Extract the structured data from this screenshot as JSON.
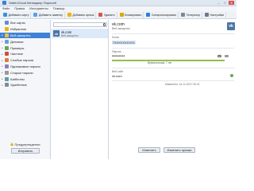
{
  "window": {
    "title": "SafeInCloud Менеджер Паролей",
    "buttons": {
      "minimize": "–",
      "maximize": "□",
      "close": "✕"
    }
  },
  "menu": [
    "Файл",
    "Правка",
    "Инструменты",
    "Помощь"
  ],
  "toolbar": [
    {
      "label": "Добавить карту",
      "icon": "add-card-icon",
      "color": "#3b8ee0"
    },
    {
      "label": "Добавить заметку",
      "icon": "add-note-icon",
      "color": "#5ba0e6"
    },
    {
      "label": "Добавить ярлык",
      "icon": "add-label-icon",
      "color": "#f0b400"
    },
    {
      "label": "Удалить",
      "icon": "delete-icon",
      "color": "#d9534f"
    },
    {
      "label": "Блокировать",
      "icon": "lock-icon",
      "color": "#e0a800"
    },
    {
      "label": "Синхронизировать",
      "icon": "sync-icon",
      "color": "#2f7de1"
    },
    {
      "label": "Генератор",
      "icon": "generator-icon",
      "color": "#7b8a99"
    },
    {
      "label": "Настройки",
      "icon": "settings-icon",
      "color": "#6c7a89"
    }
  ],
  "sidebar": {
    "categories": [
      {
        "label": "Все карты",
        "icon": "all-cards-icon",
        "color": "#5b8fd6",
        "active": false
      },
      {
        "label": "Избранное",
        "icon": "star-icon",
        "color": "#f0b400",
        "active": false
      },
      {
        "label": "Веб-аккаунты",
        "icon": "folder-icon",
        "color": "#e8c04a",
        "active": true
      },
      {
        "label": "Деловые",
        "icon": "folder-icon",
        "color": "#6a9fd8",
        "active": false
      },
      {
        "label": "Примеры",
        "icon": "folder-icon",
        "color": "#6aa84f",
        "active": false
      },
      {
        "label": "Частные",
        "icon": "folder-icon",
        "color": "#cc4b4b",
        "active": false
      },
      {
        "label": "Слабые пароли",
        "icon": "weak-icon",
        "color": "#e07b39",
        "active": false
      },
      {
        "label": "Одинаковые пароли",
        "icon": "duplicate-icon",
        "color": "#8e7cc3",
        "active": false
      },
      {
        "label": "Старые пароли",
        "icon": "clock-icon",
        "color": "#999999",
        "active": false
      },
      {
        "label": "Шаблоны",
        "icon": "template-icon",
        "color": "#5f9ea0",
        "active": false
      },
      {
        "label": "Удалённые",
        "icon": "trash-icon",
        "color": "#7f8c99",
        "active": false
      }
    ],
    "warning_label": "Предупреждения",
    "fix_button": "Исправить"
  },
  "list": {
    "search_placeholder": "",
    "entries": [
      {
        "name": "vk.com",
        "subtitle": "Веб-аккаунты",
        "logo": "vk"
      }
    ]
  },
  "detail": {
    "title": "vk.com",
    "subtitle": "Веб-аккаунты",
    "logo": "vk",
    "login_label": "Логин",
    "login_value": "79XXXXXXXX1",
    "password_label": "Пароль",
    "password_value": "••••••••",
    "password_strength": "Время взлома: 7 лет",
    "password_strength_fraction": 0.96,
    "website_label": "Веб-сайт",
    "website_value": "vk.com",
    "modified": "Изменено: 14.11.2017 00:21",
    "edit_button": "Изменить",
    "edit_labels_button": "Изменить ярлыки"
  }
}
